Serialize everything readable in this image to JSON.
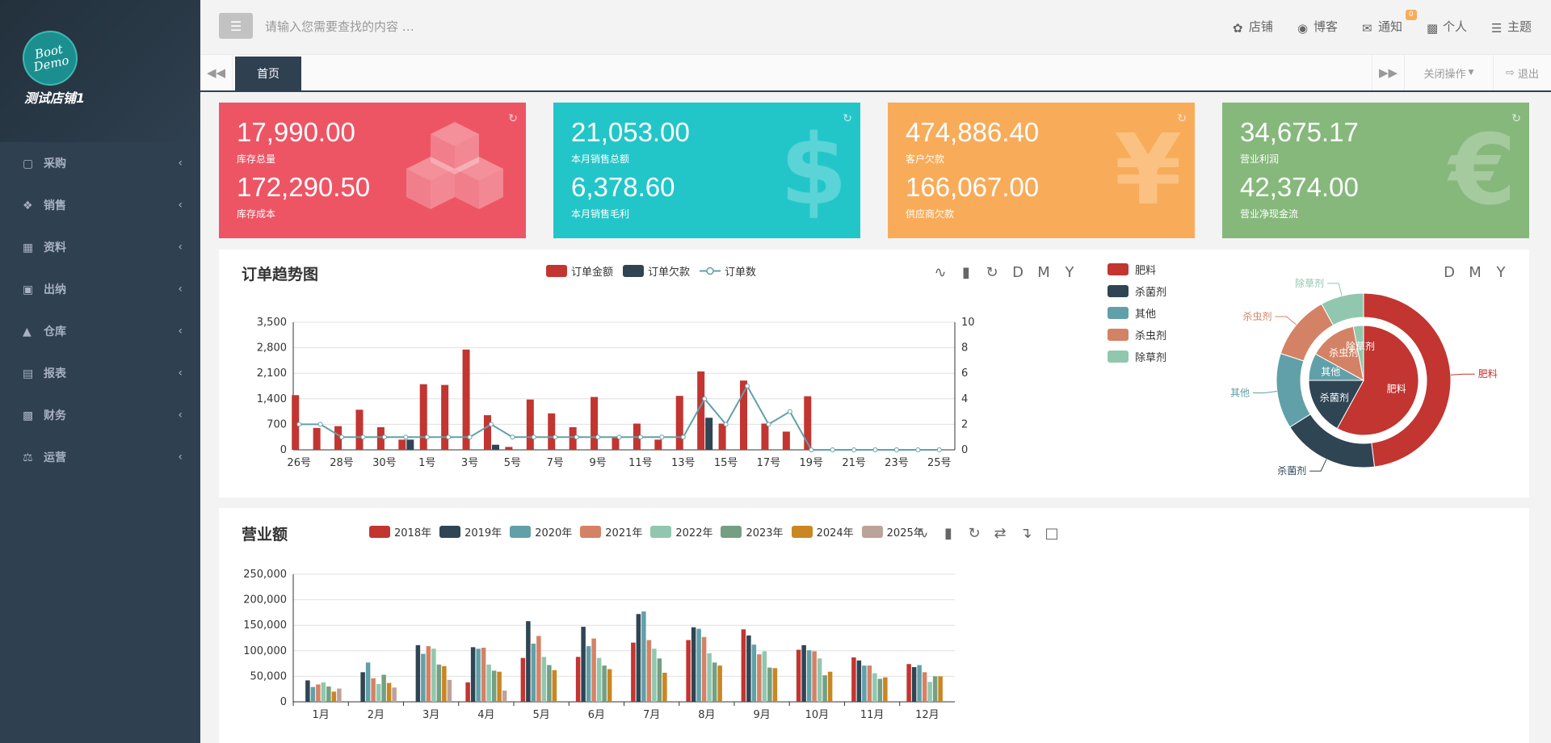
{
  "sidebar": {
    "logo_line1": "Boot",
    "logo_line2": "Demo",
    "shop_name": "测试店铺1",
    "items": [
      {
        "label": "采购",
        "icon": "briefcase-icon"
      },
      {
        "label": "销售",
        "icon": "cubes-icon"
      },
      {
        "label": "资料",
        "icon": "calendar-plus-icon"
      },
      {
        "label": "出纳",
        "icon": "money-icon"
      },
      {
        "label": "仓库",
        "icon": "bank-icon"
      },
      {
        "label": "报表",
        "icon": "newspaper-icon"
      },
      {
        "label": "财务",
        "icon": "cash-icon"
      },
      {
        "label": "运营",
        "icon": "balance-scale-icon"
      }
    ]
  },
  "topbar": {
    "search_placeholder": "请输入您需要查找的内容 …",
    "links": [
      {
        "label": "店铺",
        "icon": "paw-icon"
      },
      {
        "label": "博客",
        "icon": "rss-icon"
      },
      {
        "label": "通知",
        "icon": "envelope-icon",
        "badge": "0"
      },
      {
        "label": "个人",
        "icon": "id-card-icon"
      },
      {
        "label": "主题",
        "icon": "tasks-icon"
      }
    ]
  },
  "tabs": {
    "home": "首页",
    "close_ops": "关闭操作",
    "logout": "退出"
  },
  "cards": [
    {
      "v1": "17,990.00",
      "l1": "库存总量",
      "v2": "172,290.50",
      "l2": "库存成本",
      "color": "#ed5565",
      "icon": "cubes-icon"
    },
    {
      "v1": "21,053.00",
      "l1": "本月销售总额",
      "v2": "6,378.60",
      "l2": "本月销售毛利",
      "color": "#23c6c8",
      "icon": "dollar-icon",
      "glyph": "$"
    },
    {
      "v1": "474,886.40",
      "l1": "客户欠款",
      "v2": "166,067.00",
      "l2": "供应商欠款",
      "color": "#f8ac59",
      "icon": "yen-icon",
      "glyph": "¥"
    },
    {
      "v1": "34,675.17",
      "l1": "营业利润",
      "v2": "42,374.00",
      "l2": "营业净现金流",
      "color": "#86b87c",
      "icon": "euro-icon",
      "glyph": "€"
    }
  ],
  "order_panel": {
    "title": "订单趋势图",
    "legend": [
      "订单金额",
      "订单欠款",
      "订单数"
    ],
    "tools_left": [
      "line-chart-icon",
      "bar-chart-icon",
      "restore-icon"
    ],
    "tools_text": [
      "D",
      "M",
      "Y"
    ],
    "pie_tools_text": [
      "D",
      "M",
      "Y"
    ],
    "pie_legend": [
      "肥料",
      "杀菌剂",
      "其他",
      "杀虫剂",
      "除草剂"
    ]
  },
  "revenue_panel": {
    "title": "营业额",
    "legend": [
      "2018年",
      "2019年",
      "2020年",
      "2021年",
      "2022年",
      "2023年",
      "2024年",
      "2025年"
    ]
  },
  "colors": {
    "red": "#c23531",
    "navy": "#2f4554",
    "teal": "#61a0a8",
    "salmon": "#d48265",
    "mint": "#91c7ae",
    "green": "#749f83",
    "orange": "#ca8622",
    "tan": "#bda29a",
    "axis": "#333333"
  },
  "chart_data": [
    {
      "type": "bar",
      "title": "订单趋势图",
      "categories": [
        "26号",
        "27号",
        "28号",
        "29号",
        "30号",
        "31号",
        "1号",
        "2号",
        "3号",
        "4号",
        "5号",
        "6号",
        "7号",
        "8号",
        "9号",
        "10号",
        "11号",
        "12号",
        "13号",
        "14号",
        "15号",
        "16号",
        "17号",
        "18号",
        "19号",
        "20号",
        "21号",
        "22号",
        "23号",
        "24号",
        "25号"
      ],
      "x_tick_labels": [
        "26号",
        "28号",
        "30号",
        "1号",
        "3号",
        "5号",
        "7号",
        "9号",
        "11号",
        "13号",
        "15号",
        "17号",
        "19号",
        "21号",
        "23号",
        "25号"
      ],
      "y_left_ticks": [
        "0",
        "700",
        "1,400",
        "2,100",
        "2,800",
        "3,500"
      ],
      "y_right_ticks": [
        "0",
        "2",
        "4",
        "6",
        "8",
        "10"
      ],
      "ylim_left": [
        0,
        3500
      ],
      "ylim_right": [
        0,
        10
      ],
      "series": [
        {
          "name": "订单金额",
          "type": "bar",
          "values": [
            1500,
            600,
            650,
            1100,
            620,
            280,
            1800,
            1780,
            2750,
            950,
            80,
            1380,
            1000,
            620,
            1450,
            340,
            720,
            280,
            1480,
            2150,
            720,
            1900,
            720,
            500,
            1470,
            0,
            0,
            0,
            0,
            0,
            0
          ]
        },
        {
          "name": "订单欠款",
          "type": "bar",
          "values": [
            0,
            0,
            0,
            0,
            0,
            280,
            0,
            0,
            0,
            140,
            0,
            0,
            0,
            0,
            0,
            0,
            0,
            0,
            0,
            880,
            0,
            0,
            0,
            0,
            0,
            0,
            0,
            0,
            0,
            0,
            0
          ]
        },
        {
          "name": "订单数",
          "type": "line",
          "values": [
            2,
            2,
            1,
            1,
            1,
            1,
            1,
            1,
            1,
            2,
            1,
            1,
            1,
            1,
            1,
            1,
            1,
            1,
            1,
            4,
            2,
            5,
            2,
            3,
            0,
            0,
            0,
            0,
            0,
            0,
            0
          ]
        }
      ]
    },
    {
      "type": "pie",
      "inner_ring": [
        {
          "name": "肥料",
          "value": 58
        },
        {
          "name": "杀菌剂",
          "value": 17
        },
        {
          "name": "其他",
          "value": 8
        },
        {
          "name": "杀虫剂",
          "value": 14
        },
        {
          "name": "除草剂",
          "value": 3
        }
      ],
      "outer_ring": [
        {
          "name": "肥料",
          "value": 48
        },
        {
          "name": "杀菌剂",
          "value": 18
        },
        {
          "name": "其他",
          "value": 14
        },
        {
          "name": "杀虫剂",
          "value": 12
        },
        {
          "name": "除草剂",
          "value": 8
        }
      ]
    },
    {
      "type": "bar",
      "title": "营业额",
      "categories": [
        "1月",
        "2月",
        "3月",
        "4月",
        "5月",
        "6月",
        "7月",
        "8月",
        "9月",
        "10月",
        "11月",
        "12月"
      ],
      "y_ticks": [
        "0",
        "50,000",
        "100,000",
        "150,000",
        "200,000",
        "250,000"
      ],
      "ylim": [
        0,
        250000
      ],
      "series": [
        {
          "name": "2018年",
          "values": [
            0,
            0,
            0,
            38000,
            86000,
            88000,
            116000,
            121000,
            142000,
            102000,
            87000,
            74000
          ]
        },
        {
          "name": "2019年",
          "values": [
            42000,
            58000,
            111000,
            107000,
            158000,
            147000,
            172000,
            146000,
            130000,
            111000,
            81000,
            68000
          ]
        },
        {
          "name": "2020年",
          "values": [
            29000,
            77000,
            94000,
            104000,
            114000,
            109000,
            177000,
            143000,
            112000,
            101000,
            71000,
            72000
          ]
        },
        {
          "name": "2021年",
          "values": [
            34000,
            46000,
            109000,
            106000,
            129000,
            124000,
            121000,
            127000,
            93000,
            99000,
            71000,
            58000
          ]
        },
        {
          "name": "2022年",
          "values": [
            38000,
            35000,
            104000,
            73000,
            88000,
            86000,
            104000,
            95000,
            99000,
            85000,
            56000,
            39000
          ]
        },
        {
          "name": "2023年",
          "values": [
            30000,
            53000,
            73000,
            61000,
            72000,
            71000,
            85000,
            77000,
            67000,
            52000,
            45000,
            50000
          ]
        },
        {
          "name": "2024年",
          "values": [
            20000,
            37000,
            70000,
            59000,
            62000,
            64000,
            57000,
            71000,
            66000,
            59000,
            48000,
            50000
          ]
        },
        {
          "name": "2025年",
          "values": [
            26000,
            28000,
            43000,
            22000,
            0,
            0,
            0,
            0,
            0,
            0,
            0,
            0
          ]
        }
      ]
    }
  ]
}
